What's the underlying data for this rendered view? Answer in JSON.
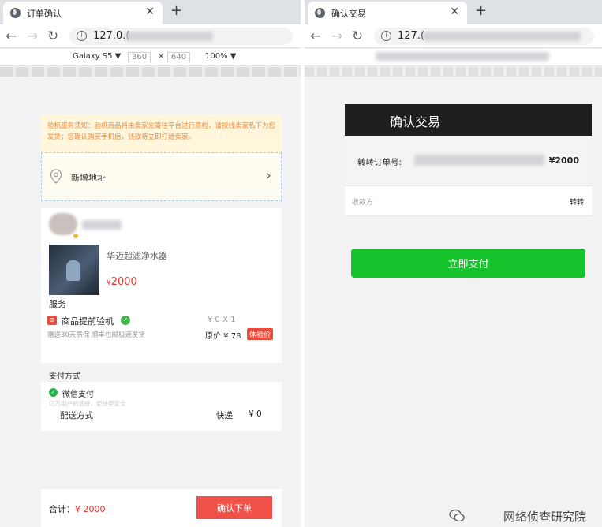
{
  "left_window": {
    "tab_title": "订单确认",
    "tab_close": "✕",
    "new_tab": "+",
    "url": "127.0.(",
    "device": "Galaxy S5 ▼",
    "width": "360",
    "times": "×",
    "height": "640",
    "zoom": "100% ▼",
    "notice": "验机服务须知：验机商品将由卖家先寄往平台进行质检，请按线卖家私下为您发货；您确认购买手机后，钱款将立即打给卖家。",
    "address_label": "新增地址",
    "product_name": "华迈超滤净水器",
    "price_symbol": "¥",
    "price": "2000",
    "service_heading": "服务",
    "service_icon": "⊕",
    "service_name": "商品提前验机",
    "service_check": "✓",
    "service_qty": "¥ 0 X 1",
    "service_desc": "赠送30天质保 顺丰包邮极速发货",
    "service_orig": "原价 ¥ 78",
    "service_tag": "体验价",
    "payment_heading": "支付方式",
    "wechat_pay": "微信支付",
    "wechat_sub": "亿万用户的选择，更快更安全",
    "shipping_label": "配送方式",
    "shipping_value": "快递",
    "shipping_price": "¥ 0",
    "total_label": "合计：",
    "total_amount": "¥ 2000",
    "order_button": "确认下单"
  },
  "right_window": {
    "tab_title": "确认交易",
    "tab_close": "✕",
    "new_tab": "+",
    "url": "127.(",
    "header_title": "确认交易",
    "order_label": "转转订单号:",
    "order_amount": "¥2000",
    "payee_label": "收款方",
    "payee_value": "转转",
    "pay_button": "立即支付"
  },
  "watermark": "网络侦查研究院",
  "colors": {
    "accent_red": "#f0524a",
    "pay_green": "#17c32c",
    "header_dark": "#1f1f1f"
  }
}
